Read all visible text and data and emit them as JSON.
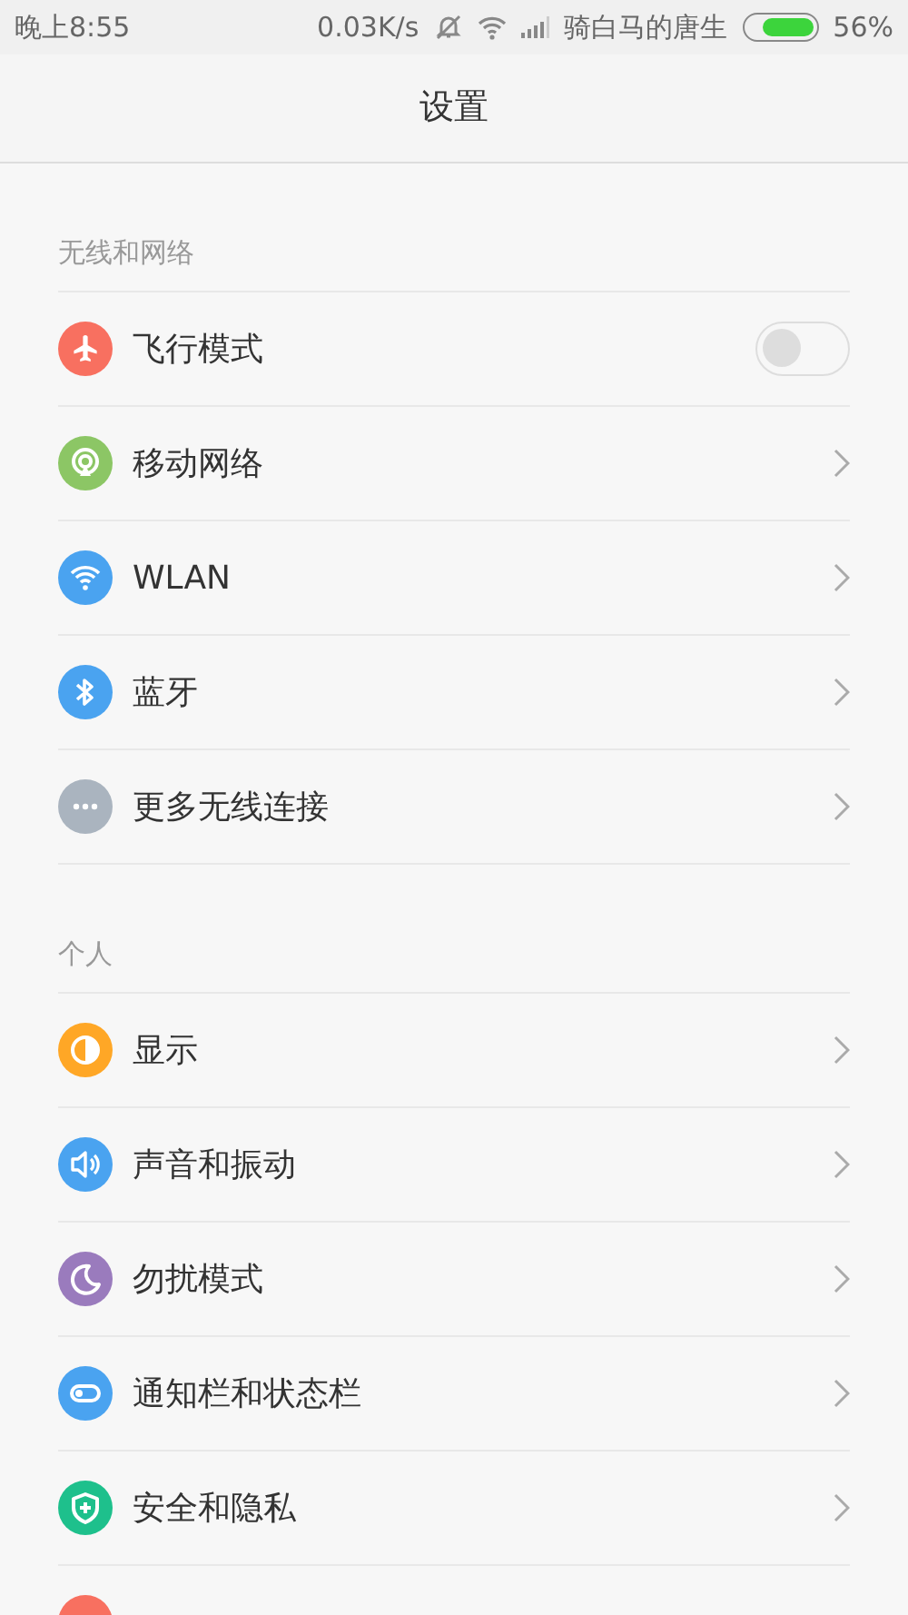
{
  "status_bar": {
    "time": "晚上8:55",
    "speed": "0.03K/s",
    "carrier": "骑白马的唐生",
    "battery": "56%"
  },
  "header": {
    "title": "设置"
  },
  "sections": [
    {
      "title": "无线和网络",
      "items": [
        {
          "label": "飞行模式",
          "color": "#f87060",
          "kind": "toggle",
          "on": false
        },
        {
          "label": "移动网络",
          "color": "#8cc665",
          "kind": "link"
        },
        {
          "label": "WLAN",
          "color": "#4aa3f0",
          "kind": "link"
        },
        {
          "label": "蓝牙",
          "color": "#4aa3f0",
          "kind": "link"
        },
        {
          "label": "更多无线连接",
          "color": "#aab4bf",
          "kind": "link"
        }
      ]
    },
    {
      "title": "个人",
      "items": [
        {
          "label": "显示",
          "color": "#ffa726",
          "kind": "link"
        },
        {
          "label": "声音和振动",
          "color": "#4aa3f0",
          "kind": "link"
        },
        {
          "label": "勿扰模式",
          "color": "#9a7bbd",
          "kind": "link"
        },
        {
          "label": "通知栏和状态栏",
          "color": "#4aa3f0",
          "kind": "link"
        },
        {
          "label": "安全和隐私",
          "color": "#1ec08c",
          "kind": "link"
        },
        {
          "color": "#f87060",
          "kind": "cut"
        }
      ]
    }
  ]
}
